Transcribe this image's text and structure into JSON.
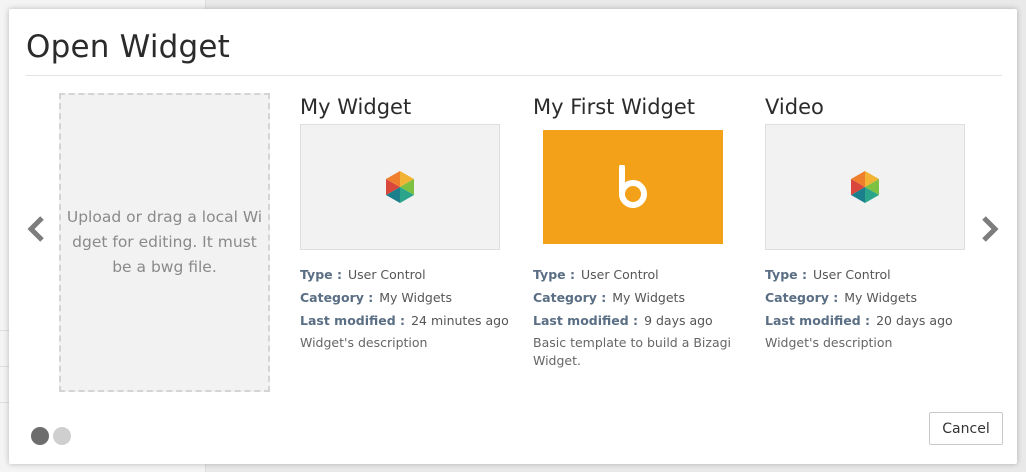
{
  "dialog": {
    "title": "Open Widget",
    "upload_text": "Upload or drag a local Widget for editing. It must be a bwg file.",
    "cancel_label": "Cancel"
  },
  "labels": {
    "type": "Type :",
    "category": "Category :",
    "last_modified": "Last modified :"
  },
  "widgets": [
    {
      "title": "My Widget",
      "thumbnail": "hexagon-logo-icon",
      "type": "User Control",
      "category": "My Widgets",
      "last_modified": "24 minutes ago",
      "description": "Widget's description"
    },
    {
      "title": "My First Widget",
      "thumbnail": "bizagi-b-logo-icon",
      "type": "User Control",
      "category": "My Widgets",
      "last_modified": "9 days ago",
      "description": "Basic template to build a Bizagi Widget."
    },
    {
      "title": "Video",
      "thumbnail": "hexagon-logo-icon",
      "type": "User Control",
      "category": "My Widgets",
      "last_modified": "20 days ago",
      "description": "Widget's description"
    }
  ],
  "pagination": {
    "pages": 2,
    "current": 1
  },
  "colors": {
    "accent_orange": "#f3a118",
    "meta_label": "#5a6e84",
    "dot_active": "#6d6d6d",
    "dot_inactive": "#cfcfcf"
  },
  "icons": {
    "prev": "chevron-left-icon",
    "next": "chevron-right-icon"
  }
}
